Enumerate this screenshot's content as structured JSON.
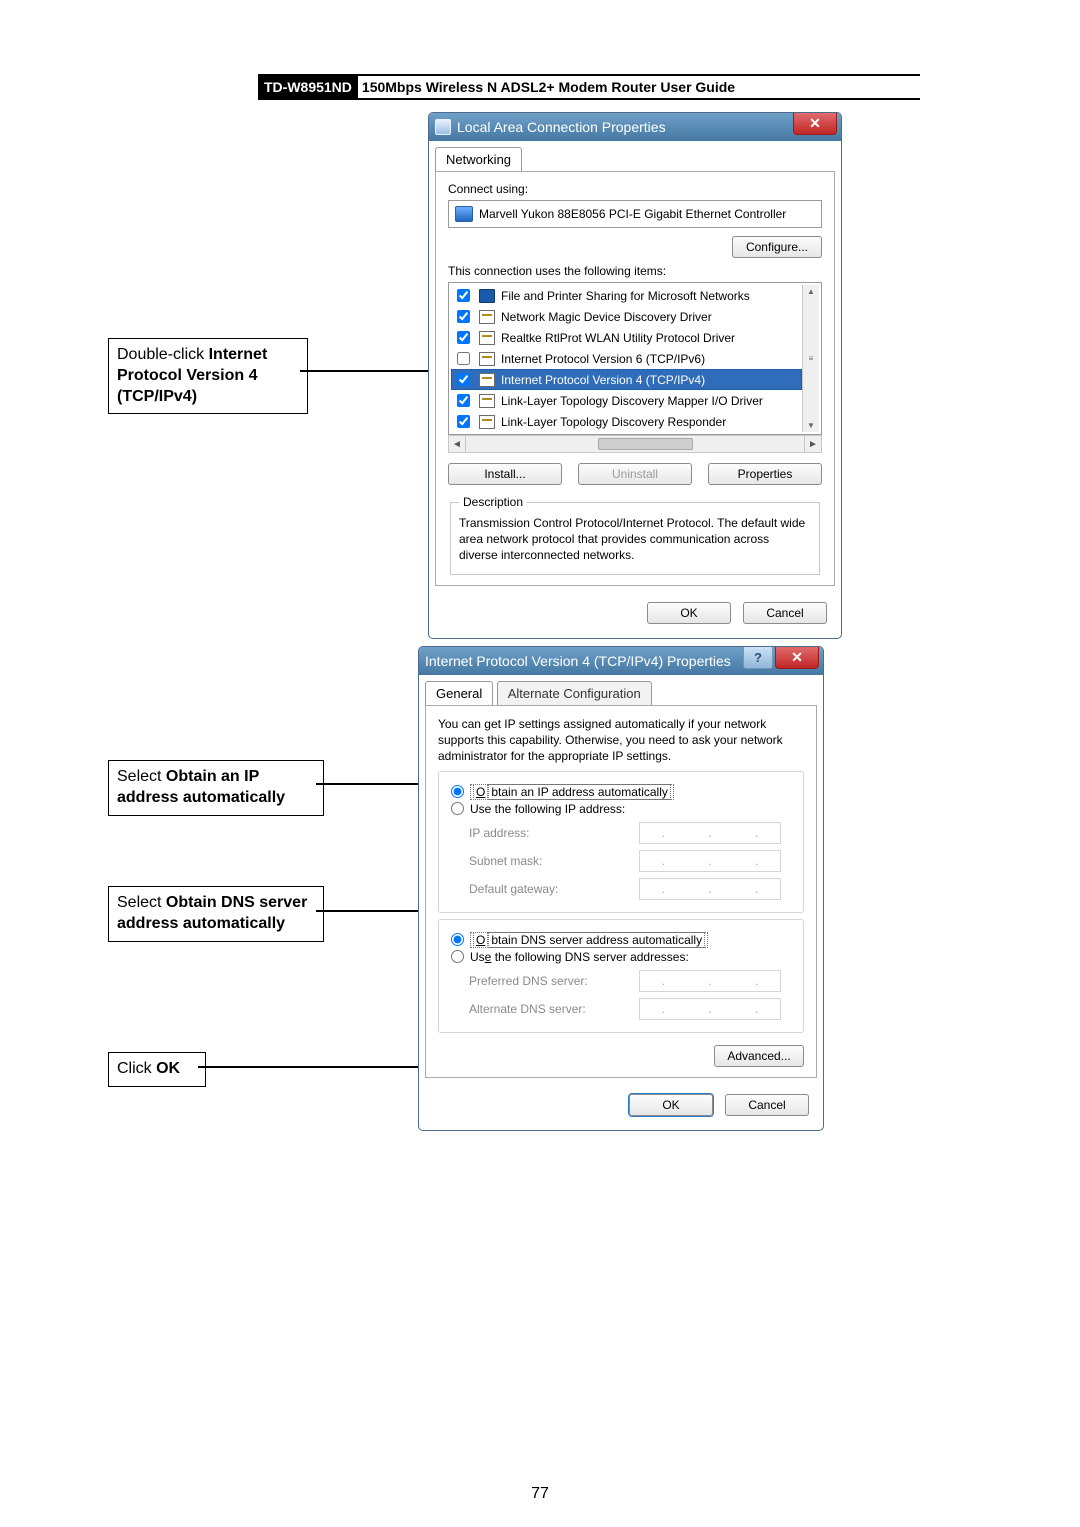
{
  "header": {
    "model": "TD-W8951ND",
    "title": "150Mbps Wireless N ADSL2+ Modem Router User Guide"
  },
  "pageNumber": "77",
  "callouts": {
    "c1_pre": "Double-click ",
    "c1_b1": "Internet Protocol Version 4 (TCP/IPv4)",
    "c2_pre": "Select ",
    "c2_b1": "Obtain an IP address automatically",
    "c3_pre": "Select ",
    "c3_b1": "Obtain DNS server address automatically",
    "c4_pre": "Click ",
    "c4_b1": "OK"
  },
  "dialog1": {
    "title": "Local Area Connection Properties",
    "tab": "Networking",
    "connect_using": "Connect using:",
    "adapter": "Marvell Yukon 88E8056 PCI-E Gigabit Ethernet Controller",
    "configure": "Configure...",
    "uses_items": "This connection uses the following items:",
    "items": [
      {
        "checked": true,
        "iconType": "printer",
        "label": "File and Printer Sharing for Microsoft Networks"
      },
      {
        "checked": true,
        "iconType": "proto",
        "label": "Network Magic Device Discovery Driver"
      },
      {
        "checked": true,
        "iconType": "proto",
        "label": "Realtke RtlProt WLAN Utility Protocol Driver"
      },
      {
        "checked": false,
        "iconType": "proto",
        "label": "Internet Protocol Version 6 (TCP/IPv6)"
      },
      {
        "checked": true,
        "iconType": "proto",
        "label": "Internet Protocol Version 4 (TCP/IPv4)",
        "selected": true
      },
      {
        "checked": true,
        "iconType": "proto",
        "label": "Link-Layer Topology Discovery Mapper I/O Driver"
      },
      {
        "checked": true,
        "iconType": "proto",
        "label": "Link-Layer Topology Discovery Responder"
      }
    ],
    "install": "Install...",
    "uninstall": "Uninstall",
    "properties": "Properties",
    "desc_legend": "Description",
    "desc_text": "Transmission Control Protocol/Internet Protocol. The default wide area network protocol that provides communication across diverse interconnected networks.",
    "ok": "OK",
    "cancel": "Cancel"
  },
  "dialog2": {
    "title": "Internet Protocol Version 4 (TCP/IPv4) Properties",
    "tab_general": "General",
    "tab_alt": "Alternate Configuration",
    "intro": "You can get IP settings assigned automatically if your network supports this capability. Otherwise, you need to ask your network administrator for the appropriate IP settings.",
    "r_obtain_ip_pre": "O",
    "r_obtain_ip_post": "btain an IP address automatically",
    "r_use_ip_pre": "Use the following IP address:",
    "ip_address": "IP address:",
    "subnet": "Subnet mask:",
    "gateway": "Default gateway:",
    "r_obtain_dns": "btain DNS server address automatically",
    "r_obtain_dns_pre": "O",
    "r_use_dns_pre": "Us",
    "r_use_dns_u": "e",
    "r_use_dns_post": " the following DNS server addresses:",
    "pref_dns": "Preferred DNS server:",
    "alt_dns": "Alternate DNS server:",
    "advanced": "Advanced...",
    "ok": "OK",
    "cancel": "Cancel"
  }
}
